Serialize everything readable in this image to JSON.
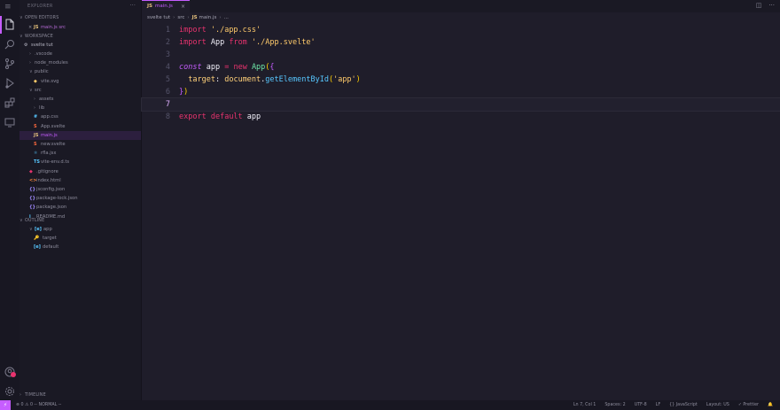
{
  "accent": "#c65dff",
  "activity": {
    "items": [
      "explorer-icon",
      "search-icon",
      "source-control-icon",
      "run-debug-icon",
      "extensions-icon",
      "remote-explorer-icon"
    ],
    "bottom": [
      "account-icon",
      "settings-gear-icon"
    ]
  },
  "sidebar": {
    "title": "EXPLORER",
    "more": "···",
    "open_editors_header": "OPEN EDITORS",
    "open_editor_file": "main.js  src",
    "workspace_header": "WORKSPACE",
    "project": "svelte tut",
    "tree": [
      {
        "label": ".vscode",
        "icon": "›",
        "indent": 1,
        "kind": "folder"
      },
      {
        "label": "node_modules",
        "icon": "›",
        "indent": 1,
        "kind": "folder"
      },
      {
        "label": "public",
        "icon": "∨",
        "indent": 1,
        "kind": "folder"
      },
      {
        "label": "vite.svg",
        "icon": "◆",
        "indent": 2,
        "kind": "file",
        "color": "#ffcb6b"
      },
      {
        "label": "src",
        "icon": "∨",
        "indent": 1,
        "kind": "folder"
      },
      {
        "label": "assets",
        "icon": "›",
        "indent": 2,
        "kind": "folder"
      },
      {
        "label": "lib",
        "icon": "›",
        "indent": 2,
        "kind": "folder"
      },
      {
        "label": "app.css",
        "icon": "#",
        "indent": 2,
        "kind": "file",
        "color": "#57c7ff"
      },
      {
        "label": "App.svelte",
        "icon": "S",
        "indent": 2,
        "kind": "file",
        "color": "#ff6a3d"
      },
      {
        "label": "main.js",
        "icon": "JS",
        "indent": 2,
        "kind": "file",
        "color": "#e5c07b",
        "selected": true
      },
      {
        "label": "new.svelte",
        "icon": "S",
        "indent": 2,
        "kind": "file",
        "color": "#ff6a3d"
      },
      {
        "label": "rfla.jsx",
        "icon": "⚛",
        "indent": 2,
        "kind": "file",
        "color": "#57c7ff"
      },
      {
        "label": "vite-env.d.ts",
        "icon": "TS",
        "indent": 2,
        "kind": "file",
        "color": "#57c7ff"
      },
      {
        "label": ".gitignore",
        "icon": "◆",
        "indent": 1,
        "kind": "file",
        "color": "#e8336e"
      },
      {
        "label": "index.html",
        "icon": "<>",
        "indent": 1,
        "kind": "file",
        "color": "#ff8a3d"
      },
      {
        "label": "jsconfig.json",
        "icon": "{}",
        "indent": 1,
        "kind": "file",
        "color": "#a28bff"
      },
      {
        "label": "package-lock.json",
        "icon": "{}",
        "indent": 1,
        "kind": "file",
        "color": "#a28bff"
      },
      {
        "label": "package.json",
        "icon": "{}",
        "indent": 1,
        "kind": "file",
        "color": "#a28bff"
      },
      {
        "label": "README.md",
        "icon": "i",
        "indent": 1,
        "kind": "file",
        "color": "#57c7ff"
      }
    ],
    "outline_header": "OUTLINE",
    "outline": [
      {
        "label": "app",
        "icon": "[e]",
        "indent": 1,
        "color": "#57c7ff"
      },
      {
        "label": "target",
        "icon": "🔑",
        "indent": 2,
        "color": "#ffcb6b"
      },
      {
        "label": "default",
        "icon": "[e]",
        "indent": 2,
        "color": "#57c7ff"
      }
    ],
    "timeline_header": "TIMELINE"
  },
  "editor": {
    "tab_label": "main.js",
    "tab_icon": "JS",
    "tab_close": "×",
    "breadcrumb": [
      "svelte tut",
      "src",
      "main.js",
      "..."
    ],
    "actions": [
      "split-editor-icon",
      "more-actions-icon"
    ],
    "current_line": 7
  },
  "status": {
    "remote": "⚡",
    "left": "⊗ 0  ⚠ 0    -- NORMAL --",
    "right": [
      "Ln 7, Col 1",
      "Spaces: 2",
      "UTF-8",
      "LF",
      "{} JavaScript",
      "Layout: US",
      "✓ Prettier",
      "🔔"
    ]
  }
}
